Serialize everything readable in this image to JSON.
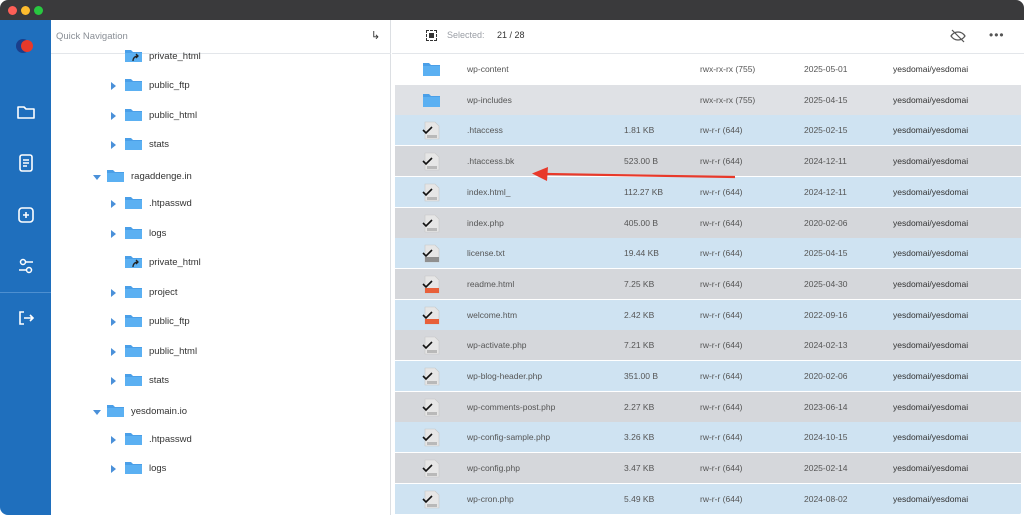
{
  "window": {
    "traffic_lights": [
      "#fe5f57",
      "#febc2e",
      "#28c840"
    ]
  },
  "sidebar": {
    "icons": [
      "folder-icon",
      "document-icon",
      "add-icon",
      "settings-icon",
      "logout-icon"
    ],
    "accent": "#1f6fbd"
  },
  "tree": {
    "title": "Quick Navigation",
    "items": [
      {
        "label": "private_html",
        "depth": 2,
        "kind": "link",
        "expanded": null
      },
      {
        "label": "public_ftp",
        "depth": 2,
        "kind": "folder",
        "expanded": false
      },
      {
        "label": "public_html",
        "depth": 2,
        "kind": "folder",
        "expanded": false
      },
      {
        "label": "stats",
        "depth": 2,
        "kind": "folder",
        "expanded": false
      },
      {
        "label": "ragaddenge.in",
        "depth": 1,
        "kind": "folder",
        "expanded": true
      },
      {
        "label": ".htpasswd",
        "depth": 2,
        "kind": "folder",
        "expanded": false
      },
      {
        "label": "logs",
        "depth": 2,
        "kind": "folder",
        "expanded": false
      },
      {
        "label": "private_html",
        "depth": 2,
        "kind": "link",
        "expanded": null
      },
      {
        "label": "project",
        "depth": 2,
        "kind": "folder",
        "expanded": false
      },
      {
        "label": "public_ftp",
        "depth": 2,
        "kind": "folder",
        "expanded": false
      },
      {
        "label": "public_html",
        "depth": 2,
        "kind": "folder",
        "expanded": false
      },
      {
        "label": "stats",
        "depth": 2,
        "kind": "folder",
        "expanded": false
      },
      {
        "label": "yesdomain.io",
        "depth": 1,
        "kind": "folder",
        "expanded": true
      },
      {
        "label": ".htpasswd",
        "depth": 2,
        "kind": "folder",
        "expanded": false
      },
      {
        "label": "logs",
        "depth": 2,
        "kind": "folder",
        "expanded": false
      }
    ]
  },
  "toolbar": {
    "selected_label": "Selected:",
    "selected_count": "21 / 28"
  },
  "files": [
    {
      "name": "wp-content",
      "size": "",
      "perm": "rwx-rx-rx (755)",
      "date": "2025-05-01",
      "owner": "yesdomai/yesdomai",
      "type": "folder",
      "selected": false
    },
    {
      "name": "wp-includes",
      "size": "",
      "perm": "rwx-rx-rx (755)",
      "date": "2025-04-15",
      "owner": "yesdomai/yesdomai",
      "type": "folder",
      "selected": false
    },
    {
      "name": ".htaccess",
      "size": "1.81 KB",
      "perm": "rw-r-r (644)",
      "date": "2025-02-15",
      "owner": "yesdomai/yesdomai",
      "type": "file",
      "selected": true
    },
    {
      "name": ".htaccess.bk",
      "size": "523.00 B",
      "perm": "rw-r-r (644)",
      "date": "2024-12-11",
      "owner": "yesdomai/yesdomai",
      "type": "file",
      "selected": true
    },
    {
      "name": "index.html_",
      "size": "112.27 KB",
      "perm": "rw-r-r (644)",
      "date": "2024-12-11",
      "owner": "yesdomai/yesdomai",
      "type": "file",
      "selected": true
    },
    {
      "name": "index.php",
      "size": "405.00 B",
      "perm": "rw-r-r (644)",
      "date": "2020-02-06",
      "owner": "yesdomai/yesdomai",
      "type": "file",
      "selected": true
    },
    {
      "name": "license.txt",
      "size": "19.44 KB",
      "perm": "rw-r-r (644)",
      "date": "2025-04-15",
      "owner": "yesdomai/yesdomai",
      "type": "txt",
      "selected": true
    },
    {
      "name": "readme.html",
      "size": "7.25 KB",
      "perm": "rw-r-r (644)",
      "date": "2025-04-30",
      "owner": "yesdomai/yesdomai",
      "type": "html",
      "selected": true
    },
    {
      "name": "welcome.htm",
      "size": "2.42 KB",
      "perm": "rw-r-r (644)",
      "date": "2022-09-16",
      "owner": "yesdomai/yesdomai",
      "type": "html",
      "selected": true
    },
    {
      "name": "wp-activate.php",
      "size": "7.21 KB",
      "perm": "rw-r-r (644)",
      "date": "2024-02-13",
      "owner": "yesdomai/yesdomai",
      "type": "file",
      "selected": true
    },
    {
      "name": "wp-blog-header.php",
      "size": "351.00 B",
      "perm": "rw-r-r (644)",
      "date": "2020-02-06",
      "owner": "yesdomai/yesdomai",
      "type": "file",
      "selected": true
    },
    {
      "name": "wp-comments-post.php",
      "size": "2.27 KB",
      "perm": "rw-r-r (644)",
      "date": "2023-06-14",
      "owner": "yesdomai/yesdomai",
      "type": "file",
      "selected": true
    },
    {
      "name": "wp-config-sample.php",
      "size": "3.26 KB",
      "perm": "rw-r-r (644)",
      "date": "2024-10-15",
      "owner": "yesdomai/yesdomai",
      "type": "file",
      "selected": true
    },
    {
      "name": "wp-config.php",
      "size": "3.47 KB",
      "perm": "rw-r-r (644)",
      "date": "2025-02-14",
      "owner": "yesdomai/yesdomai",
      "type": "file",
      "selected": true
    },
    {
      "name": "wp-cron.php",
      "size": "5.49 KB",
      "perm": "rw-r-r (644)",
      "date": "2024-08-02",
      "owner": "yesdomai/yesdomai",
      "type": "file",
      "selected": true
    }
  ],
  "annotation": {
    "arrow_color": "#e8392a",
    "points_to": ".htaccess.bk"
  }
}
